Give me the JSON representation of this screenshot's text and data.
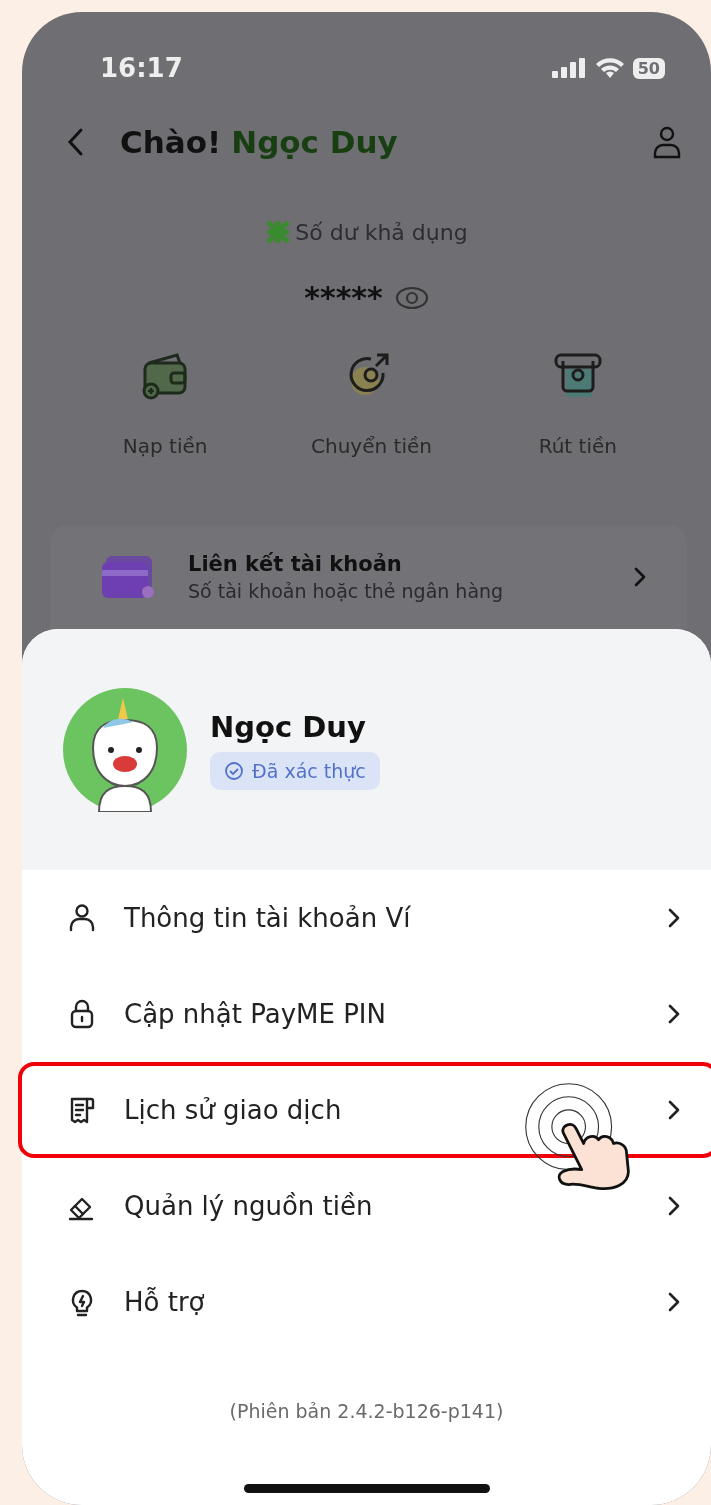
{
  "status_bar": {
    "time": "16:17",
    "battery": "50"
  },
  "header": {
    "greeting": "Chào!",
    "name": "Ngọc Duy"
  },
  "balance": {
    "label": "Số dư khả dụng",
    "value": "*****"
  },
  "actions": [
    {
      "label": "Nạp tiền"
    },
    {
      "label": "Chuyển tiền"
    },
    {
      "label": "Rút tiền"
    }
  ],
  "linked_account": {
    "title": "Liên kết tài khoản",
    "subtitle": "Số tài khoản hoặc thẻ ngân hàng"
  },
  "profile": {
    "name": "Ngọc Duy",
    "badge": "Đã xác thực"
  },
  "menu": [
    {
      "label": "Thông tin tài khoản Ví",
      "highlighted": false
    },
    {
      "label": "Cập nhật PayME PIN",
      "highlighted": false
    },
    {
      "label": "Lịch sử giao dịch",
      "highlighted": true
    },
    {
      "label": "Quản lý nguồn tiền",
      "highlighted": false
    },
    {
      "label": "Hỗ trợ",
      "highlighted": false
    }
  ],
  "version": "(Phiên bản 2.4.2-b126-p141)"
}
